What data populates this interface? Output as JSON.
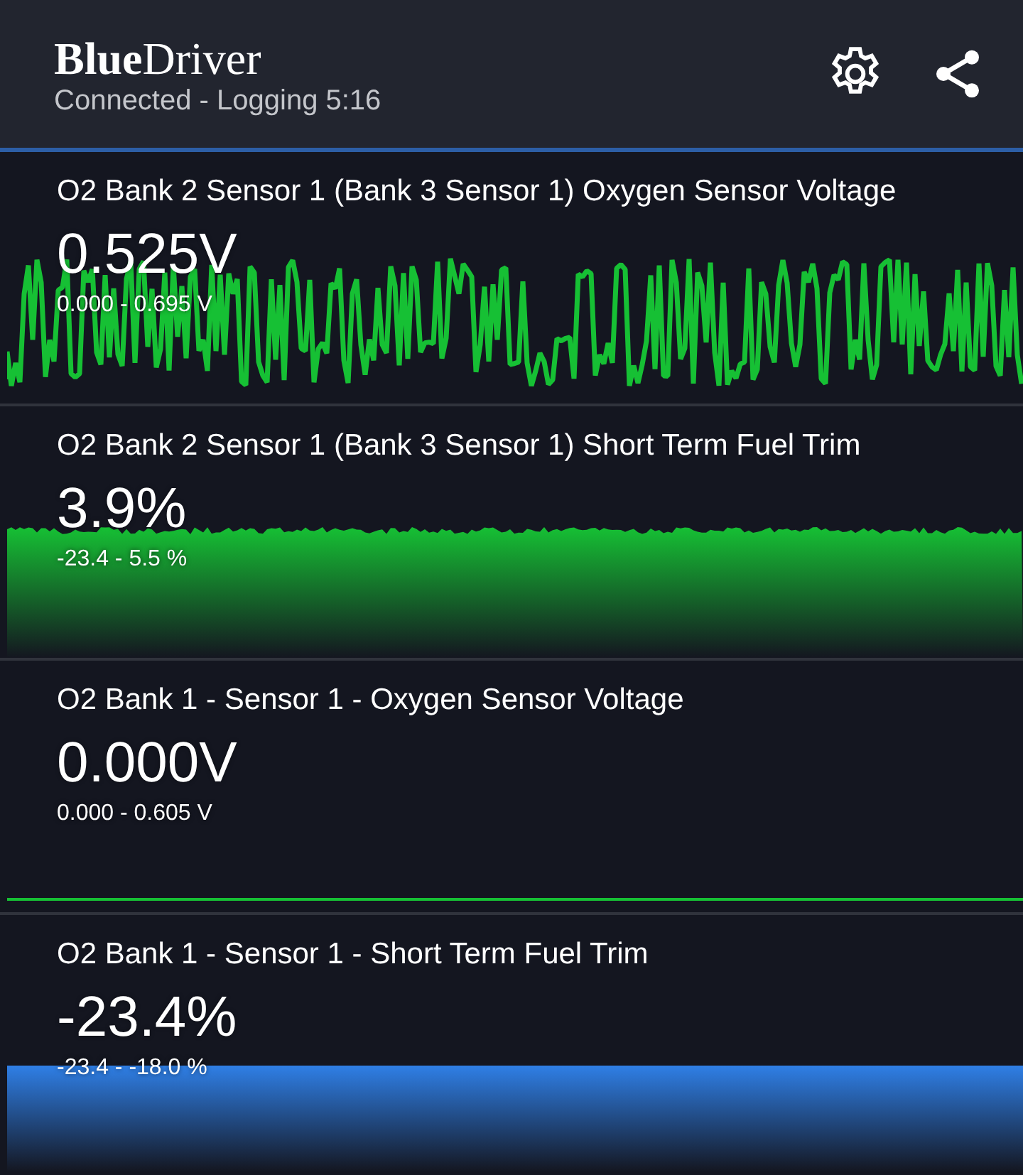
{
  "app_bar": {
    "logo": "**Blue**Driver",
    "status": "Connected - Logging 5:16"
  },
  "gauges": [
    {
      "title": "O2 Bank 2 Sensor 1 (Bank 3 Sensor 1) Oxygen Sensor Voltage",
      "value": "0.525V",
      "range": "0.000 - 0.695 V",
      "graph": {
        "kind": "spiky",
        "color": "#16c034"
      }
    },
    {
      "title": "O2 Bank 2 Sensor 1 (Bank 3 Sensor 1) Short Term Fuel Trim",
      "value": "3.9%",
      "range": "-23.4 - 5.5 %",
      "graph": {
        "kind": "area",
        "color": "#16c034"
      }
    },
    {
      "title": "O2 Bank 1 - Sensor 1 - Oxygen Sensor Voltage",
      "value": "0.000V",
      "range": "0.000 - 0.605 V",
      "graph": {
        "kind": "flat",
        "color": "#16c034"
      }
    },
    {
      "title": "O2 Bank 1 - Sensor 1 - Short Term Fuel Trim",
      "value": "-23.4%",
      "range": "-23.4 - -18.0 %",
      "graph": {
        "kind": "band",
        "color": "#2f7fe6"
      }
    }
  ]
}
